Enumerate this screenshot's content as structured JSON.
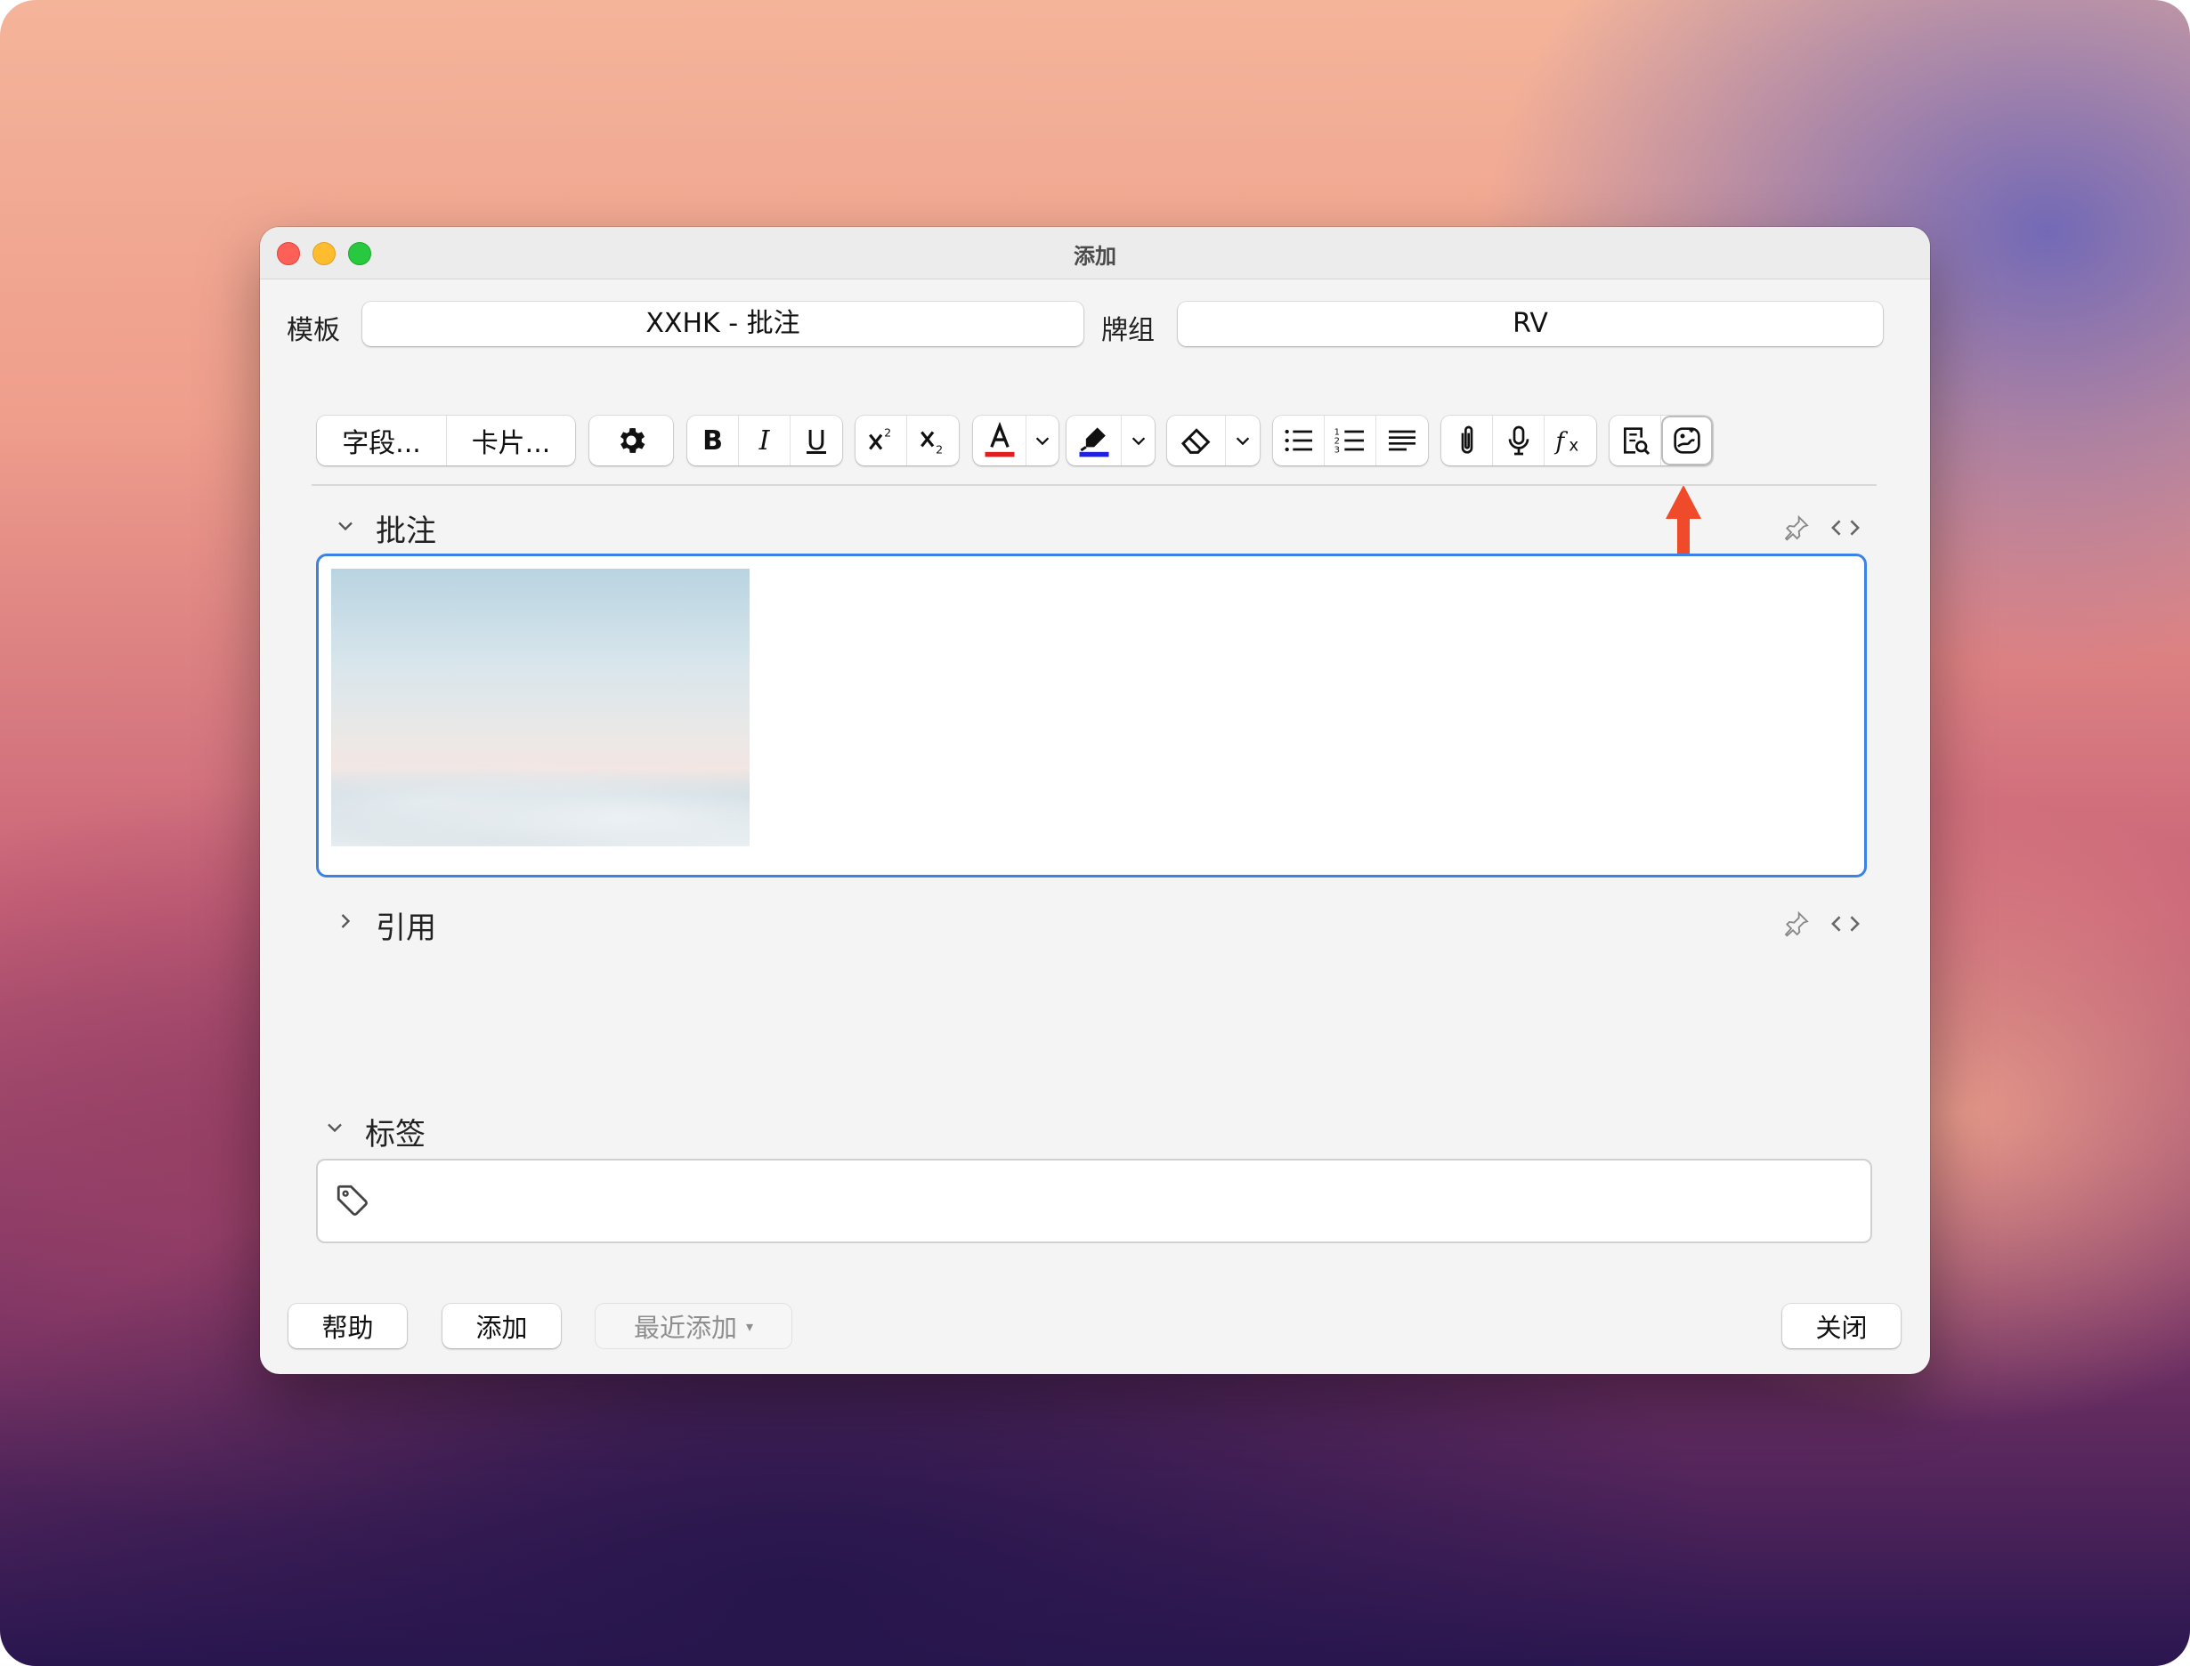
{
  "window": {
    "title": "添加"
  },
  "top_fields": {
    "note_type_label": "模板",
    "note_type_value": "XXHK - 批注",
    "deck_label": "牌组",
    "deck_value": "RV"
  },
  "toolbar": {
    "fields_label": "字段...",
    "cards_label": "卡片...",
    "bold_label": "B",
    "italic_label": "I",
    "underline_label": "U",
    "text_color": "#e02020",
    "highlight_color": "#2020e0"
  },
  "fields": [
    {
      "label": "批注",
      "expanded": true
    },
    {
      "label": "引用",
      "expanded": false
    }
  ],
  "tags": {
    "label": "标签"
  },
  "buttons": {
    "help": "帮助",
    "add": "添加",
    "history": "最近添加",
    "history_caret": "▾",
    "close": "关闭"
  },
  "colors": {
    "accent": "#3b82e6",
    "annotation_arrow": "#ef4b2a"
  }
}
